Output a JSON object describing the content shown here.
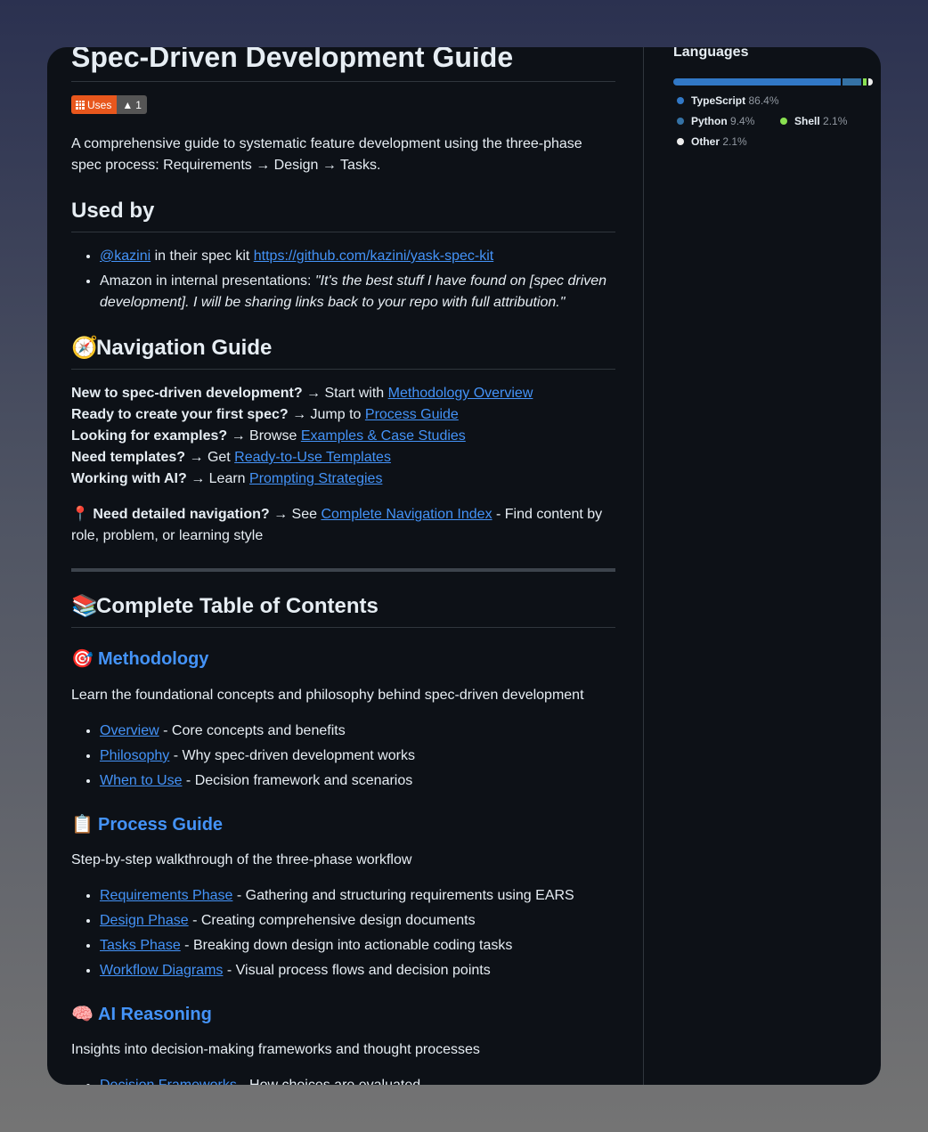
{
  "readme": {
    "title": "Spec-Driven Development Guide",
    "badge": {
      "label": "Uses",
      "count": "1",
      "left_icon": "grid-icon",
      "right_icon": "triangle-icon",
      "left_color": "#e8571d"
    },
    "intro": "A comprehensive guide to systematic feature development using the three-phase spec process: Requirements → Design → Tasks.",
    "used_by": {
      "heading": "Used by",
      "item1": {
        "user": "@kazini",
        "middle": " in their spec kit ",
        "url": "https://github.com/kazini/yask-spec-kit"
      },
      "item2": {
        "prefix": "Amazon in internal presentations: ",
        "quote": "\"It's the best stuff I have found on [spec driven development]. I will be sharing links back to your repo with full attribution.\""
      }
    },
    "navigation": {
      "emoji": "🧭",
      "heading": "Navigation Guide",
      "lines": [
        {
          "q": "New to spec-driven development?",
          "action": " → Start with ",
          "link": "Methodology Overview"
        },
        {
          "q": "Ready to create your first spec?",
          "action": " → Jump to ",
          "link": "Process Guide"
        },
        {
          "q": "Looking for examples?",
          "action": " → Browse ",
          "link": "Examples & Case Studies"
        },
        {
          "q": "Need templates?",
          "action": " → Get ",
          "link": "Ready-to-Use Templates"
        },
        {
          "q": "Working with AI?",
          "action": " → Learn ",
          "link": "Prompting Strategies"
        }
      ],
      "detailed": {
        "emoji": "📍",
        "q": "Need detailed navigation?",
        "action": " → See ",
        "link": "Complete Navigation Index",
        "rest": " - Find content by role, problem, or learning style"
      }
    },
    "toc": {
      "emoji": "📚",
      "heading": "Complete Table of Contents",
      "methodology": {
        "emoji": "🎯",
        "heading": "Methodology",
        "desc": "Learn the foundational concepts and philosophy behind spec-driven development",
        "items": [
          {
            "link": "Overview",
            "text": " - Core concepts and benefits"
          },
          {
            "link": "Philosophy",
            "text": " - Why spec-driven development works"
          },
          {
            "link": "When to Use",
            "text": " - Decision framework and scenarios"
          }
        ]
      },
      "process": {
        "emoji": "📋",
        "heading": "Process Guide",
        "desc": "Step-by-step walkthrough of the three-phase workflow",
        "items": [
          {
            "link": "Requirements Phase",
            "text": " - Gathering and structuring requirements using EARS"
          },
          {
            "link": "Design Phase",
            "text": " - Creating comprehensive design documents"
          },
          {
            "link": "Tasks Phase",
            "text": " - Breaking down design into actionable coding tasks"
          },
          {
            "link": "Workflow Diagrams",
            "text": " - Visual process flows and decision points"
          }
        ]
      },
      "ai": {
        "emoji": "🧠",
        "heading": "AI Reasoning",
        "desc": "Insights into decision-making frameworks and thought processes",
        "items": [
          {
            "link": "Decision Frameworks",
            "text": " - How choices are evaluated"
          }
        ]
      }
    }
  },
  "sidebar": {
    "languages_title": "Languages",
    "languages": [
      {
        "name": "TypeScript",
        "percent": "86.4%",
        "value": 86.4,
        "color": "#3178c6"
      },
      {
        "name": "Python",
        "percent": "9.4%",
        "value": 9.4,
        "color": "#3572a5"
      },
      {
        "name": "Shell",
        "percent": "2.1%",
        "value": 2.1,
        "color": "#89e051"
      },
      {
        "name": "Other",
        "percent": "2.1%",
        "value": 2.1,
        "color": "#ededed"
      }
    ]
  }
}
